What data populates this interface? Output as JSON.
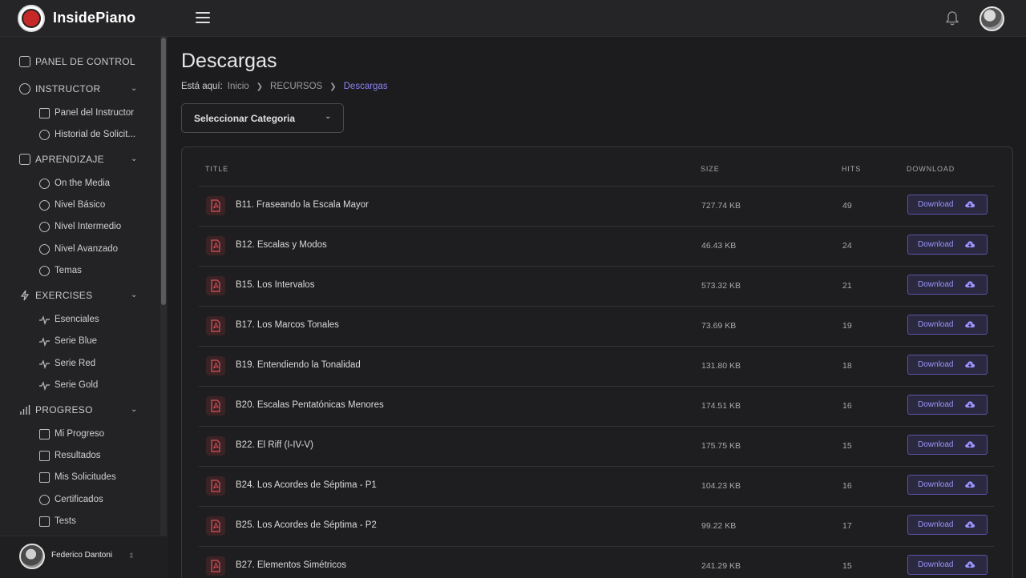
{
  "app": {
    "brand": "InsidePiano"
  },
  "sidebar": {
    "sections": [
      {
        "label": "PANEL DE CONTROL"
      },
      {
        "label": "INSTRUCTOR",
        "items": [
          {
            "label": "Panel del Instructor"
          },
          {
            "label": "Historial de Solicit..."
          }
        ]
      },
      {
        "label": "APRENDIZAJE",
        "items": [
          {
            "label": "On the Media"
          },
          {
            "label": "Nivel Básico"
          },
          {
            "label": "Nivel Intermedio"
          },
          {
            "label": "Nivel Avanzado"
          },
          {
            "label": "Temas"
          }
        ]
      },
      {
        "label": "EXERCISES",
        "items": [
          {
            "label": "Esenciales"
          },
          {
            "label": "Serie Blue"
          },
          {
            "label": "Serie Red"
          },
          {
            "label": "Serie Gold"
          }
        ]
      },
      {
        "label": "PROGRESO",
        "items": [
          {
            "label": "Mi Progreso"
          },
          {
            "label": "Resultados"
          },
          {
            "label": "Mis Solicitudes"
          },
          {
            "label": "Certificados"
          },
          {
            "label": "Tests"
          }
        ]
      }
    ],
    "user": {
      "name": "Federico Dantoni"
    }
  },
  "main": {
    "title": "Descargas",
    "breadcrumb": {
      "lead": "Está aquí:",
      "items": [
        "Inicio",
        "RECURSOS",
        "Descargas"
      ]
    },
    "category_select": {
      "label": "Seleccionar Categoria"
    },
    "table": {
      "headers": {
        "title": "TITLE",
        "size": "SIZE",
        "hits": "HITS",
        "download": "DOWNLOAD"
      },
      "download_label": "Download",
      "rows": [
        {
          "title": "B11. Fraseando la Escala Mayor",
          "size": "727.74 KB",
          "hits": "49"
        },
        {
          "title": "B12. Escalas y Modos",
          "size": "46.43 KB",
          "hits": "24"
        },
        {
          "title": "B15. Los Intervalos",
          "size": "573.32 KB",
          "hits": "21"
        },
        {
          "title": "B17. Los Marcos Tonales",
          "size": "73.69 KB",
          "hits": "19"
        },
        {
          "title": "B19. Entendiendo la Tonalidad",
          "size": "131.80 KB",
          "hits": "18"
        },
        {
          "title": "B20. Escalas Pentatónicas Menores",
          "size": "174.51 KB",
          "hits": "16"
        },
        {
          "title": "B22. El Riff (I-IV-V)",
          "size": "175.75 KB",
          "hits": "15"
        },
        {
          "title": "B24. Los Acordes de Séptima - P1",
          "size": "104.23 KB",
          "hits": "16"
        },
        {
          "title": "B25. Los Acordes de Séptima - P2",
          "size": "99.22 KB",
          "hits": "17"
        },
        {
          "title": "B27. Elementos Simétricos",
          "size": "241.29 KB",
          "hits": "15"
        }
      ]
    }
  },
  "colors": {
    "accent": "#8b83f3",
    "pdf": "#e0505a",
    "background": "#1c1c1e"
  },
  "icons": {
    "pdf": "pdf-file-icon",
    "download": "cloud-download-icon",
    "bell": "bell-icon",
    "menu": "hamburger-icon"
  }
}
